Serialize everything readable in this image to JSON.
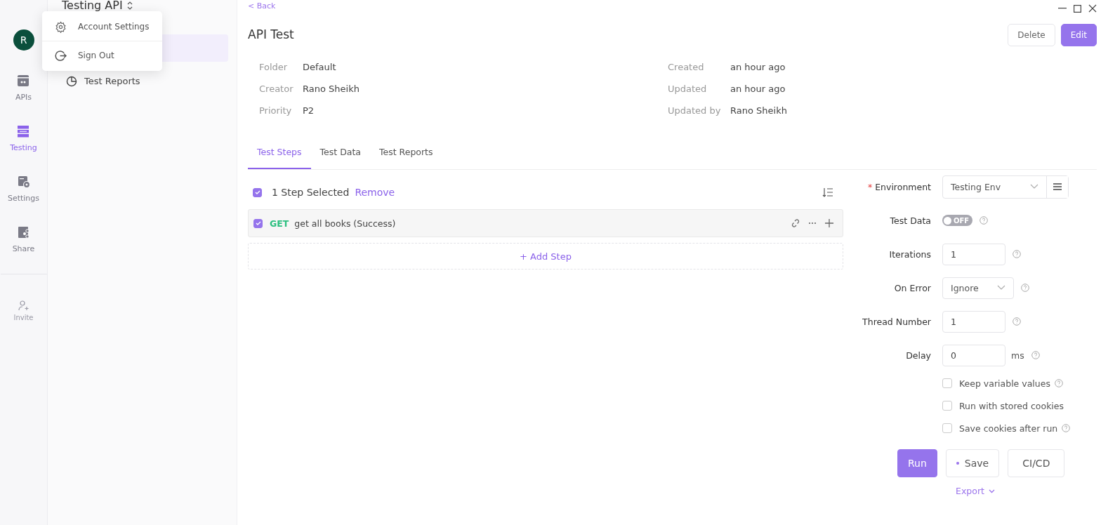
{
  "rail": {
    "avatar": "R",
    "items": [
      {
        "label": "APIs",
        "selected": false,
        "kind": "apis"
      },
      {
        "label": "Testing",
        "selected": true,
        "kind": "testing"
      },
      {
        "label": "Settings",
        "selected": false,
        "kind": "settings"
      },
      {
        "label": "Share",
        "selected": false,
        "kind": "share"
      }
    ],
    "invite": "Invite"
  },
  "account_menu": [
    {
      "label": "Account Settings",
      "kind": "gear"
    },
    {
      "label": "Sign Out",
      "kind": "signout"
    }
  ],
  "sidebar": {
    "title": "Testing API",
    "items": [
      {
        "selected": true
      },
      {
        "label": "Test Reports",
        "selected": false
      }
    ]
  },
  "back": "< Back",
  "title": "API Test",
  "buttons": [
    {
      "label": "Delete",
      "kind": "secondary"
    },
    {
      "label": "Edit",
      "kind": "primary"
    }
  ],
  "info_left": [
    {
      "label": "Folder",
      "value": "Default"
    },
    {
      "label": "Creator",
      "value": "Rano Sheikh"
    },
    {
      "label": "Priority",
      "value": "P2"
    }
  ],
  "info_right": [
    {
      "label": "Created",
      "value": "an hour ago"
    },
    {
      "label": "Updated",
      "value": "an hour ago"
    },
    {
      "label": "Updated by",
      "value": "Rano Sheikh"
    }
  ],
  "tabs": [
    {
      "label": "Test Steps",
      "selected": true
    },
    {
      "label": "Test Data",
      "selected": false
    },
    {
      "label": "Test Reports",
      "selected": false
    }
  ],
  "selection": {
    "checked": true,
    "text": "1 Step Selected",
    "action": "Remove"
  },
  "steps": [
    {
      "method": "GET",
      "name": "get all books (Success)",
      "checked": true
    }
  ],
  "add_step": "+ Add Step",
  "settings": {
    "environment": {
      "required_mark": "*",
      "label": "Environment",
      "value": "Testing Env"
    },
    "test_data": {
      "label": "Test Data",
      "on": false,
      "text": "OFF"
    },
    "iterations": {
      "label": "Iterations",
      "value": "1"
    },
    "on_error": {
      "label": "On Error",
      "value": "Ignore"
    },
    "thread_number": {
      "label": "Thread Number",
      "value": "1"
    },
    "delay": {
      "label": "Delay",
      "value": "0",
      "unit": "ms"
    },
    "options": [
      {
        "label": "Keep variable values",
        "checked": false,
        "help": true
      },
      {
        "label": "Run with stored cookies",
        "checked": false,
        "help": false
      },
      {
        "label": "Save cookies after run",
        "checked": false,
        "help": true
      }
    ]
  },
  "actions": [
    {
      "label": "Run",
      "kind": "primary"
    },
    {
      "label": "Save",
      "kind": "dot"
    },
    {
      "label": "CI/CD",
      "kind": "plain"
    }
  ],
  "export": "Export"
}
